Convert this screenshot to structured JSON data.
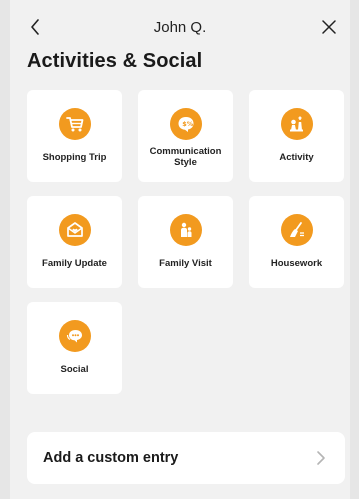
{
  "header": {
    "title": "John Q.",
    "back_icon": "chevron-left-icon",
    "close_icon": "close-icon"
  },
  "page": {
    "title": "Activities & Social"
  },
  "accent_color": "#f29a1f",
  "cards": [
    {
      "label": "Shopping Trip",
      "icon": "shopping-cart-icon"
    },
    {
      "label": "Communication Style",
      "icon": "speech-bubble-icon"
    },
    {
      "label": "Activity",
      "icon": "chess-pieces-icon"
    },
    {
      "label": "Family Update",
      "icon": "envelope-icon"
    },
    {
      "label": "Family Visit",
      "icon": "family-icon"
    },
    {
      "label": "Housework",
      "icon": "broom-icon"
    },
    {
      "label": "Social",
      "icon": "chat-bubbles-icon"
    }
  ],
  "custom_entry": {
    "label": "Add a custom entry",
    "icon": "chevron-right-icon"
  }
}
